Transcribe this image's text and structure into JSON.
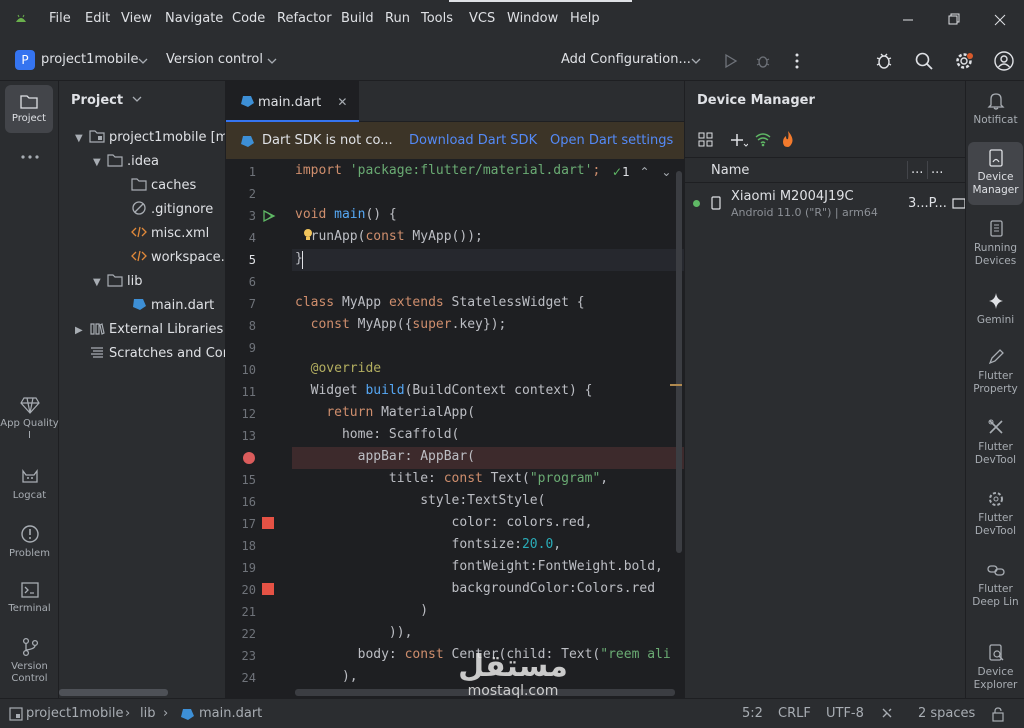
{
  "menu": {
    "items": [
      "File",
      "Edit",
      "View",
      "Navigate",
      "Code",
      "Refactor",
      "Build",
      "Run",
      "Tools",
      "VCS",
      "Window",
      "Help"
    ]
  },
  "toolbar": {
    "project_badge": "P",
    "project_name": "project1mobile",
    "version_control": "Version control",
    "run_config": "Add Configuration..."
  },
  "left_strip": {
    "project": "Project",
    "app_quality": "App Quality I",
    "logcat": "Logcat",
    "problems": "Problem",
    "terminal": "Terminal",
    "version_control": "Version Control"
  },
  "project_panel": {
    "title": "Project",
    "tree": [
      {
        "label": "project1mobile [my"
      },
      {
        "label": ".idea"
      },
      {
        "label": "caches"
      },
      {
        "label": ".gitignore"
      },
      {
        "label": "misc.xml"
      },
      {
        "label": "workspace.x"
      },
      {
        "label": "lib"
      },
      {
        "label": "main.dart"
      },
      {
        "label": "External Libraries"
      },
      {
        "label": "Scratches and Cor"
      }
    ]
  },
  "editor": {
    "tab_label": "main.dart",
    "banner_text": "Dart SDK is not co...",
    "banner_link1": "Download Dart SDK",
    "banner_link2": "Open Dart settings",
    "inspection_count": "1",
    "line_numbers": [
      "1",
      "2",
      "3",
      "4",
      "5",
      "6",
      "7",
      "8",
      "9",
      "10",
      "11",
      "12",
      "13",
      "14",
      "15",
      "16",
      "17",
      "18",
      "19",
      "20",
      "21",
      "22",
      "23",
      "24"
    ]
  },
  "device_manager": {
    "title": "Device Manager",
    "column_name": "Name",
    "column_more1": "...",
    "column_more2": "...",
    "device_name": "Xiaomi M2004J19C",
    "device_sub": "Android 11.0 (\"R\") | arm64",
    "device_extra": "3...P..."
  },
  "right_strip": {
    "notifications": "Notificat",
    "device_manager": "Device Manager",
    "running_devices": "Running Devices",
    "gemini": "Gemini",
    "flutter_property": "Flutter Property",
    "flutter_devtool1": "Flutter DevTool",
    "flutter_devtool2": "Flutter DevTool",
    "flutter_deeplink": "Flutter Deep Lin",
    "device_explorer": "Device Explorer"
  },
  "status_bar": {
    "crumb1": "project1mobile",
    "crumb2": "lib",
    "crumb3": "main.dart",
    "position": "5:2",
    "line_sep": "CRLF",
    "encoding": "UTF-8",
    "indent": "2 spaces"
  },
  "watermark": {
    "arabic": "مستقل",
    "latin": "mostaql.com"
  },
  "colors": {
    "accent": "#3574f0",
    "breakpoint": "#db5c5c",
    "keyword": "#cf8e6d",
    "string": "#6aab73"
  }
}
